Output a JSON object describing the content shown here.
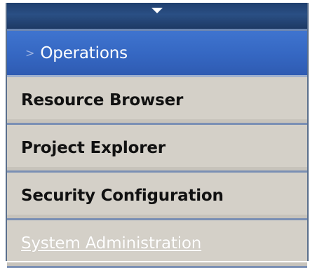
{
  "menu": {
    "items": [
      {
        "label": "Operations",
        "state": "selected"
      },
      {
        "label": "Resource Browser",
        "state": "normal"
      },
      {
        "label": "Project Explorer",
        "state": "normal"
      },
      {
        "label": "Security Configuration",
        "state": "normal"
      },
      {
        "label": "System Administration",
        "state": "disabled"
      }
    ]
  },
  "icons": {
    "collapse": "triangle-down-icon",
    "selected_marker": "chevron-right-icon"
  },
  "colors": {
    "header": "#1f3f6e",
    "selected": "#3567c2",
    "item_bg": "#d4d0c8",
    "separator": "#7a8fb4"
  }
}
